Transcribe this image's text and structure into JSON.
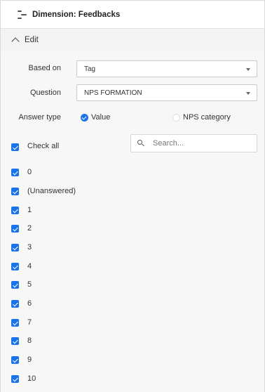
{
  "header": {
    "title": "Dimension: Feedbacks",
    "icon": "dimension-icon"
  },
  "edit": {
    "label": "Edit",
    "icon": "chevron-up-icon"
  },
  "form": {
    "based_on": {
      "label": "Based on",
      "value": "Tag"
    },
    "question": {
      "label": "Question",
      "value": "NPS FORMATION"
    },
    "answer_type": {
      "label": "Answer type",
      "options": [
        {
          "label": "Value",
          "checked": true
        },
        {
          "label": "NPS category",
          "checked": false
        }
      ]
    }
  },
  "check_all": {
    "label": "Check all",
    "checked": true
  },
  "search": {
    "placeholder": "Search..."
  },
  "values": [
    {
      "label": "0",
      "checked": true
    },
    {
      "label": "(Unanswered)",
      "checked": true
    },
    {
      "label": "1",
      "checked": true
    },
    {
      "label": "2",
      "checked": true
    },
    {
      "label": "3",
      "checked": true
    },
    {
      "label": "4",
      "checked": true
    },
    {
      "label": "5",
      "checked": true
    },
    {
      "label": "6",
      "checked": true
    },
    {
      "label": "7",
      "checked": true
    },
    {
      "label": "8",
      "checked": true
    },
    {
      "label": "9",
      "checked": true
    },
    {
      "label": "10",
      "checked": true
    }
  ],
  "colors": {
    "accent": "#1a73e8",
    "edit_bar": "#f4f4f4",
    "body": "#f7f7f7"
  }
}
